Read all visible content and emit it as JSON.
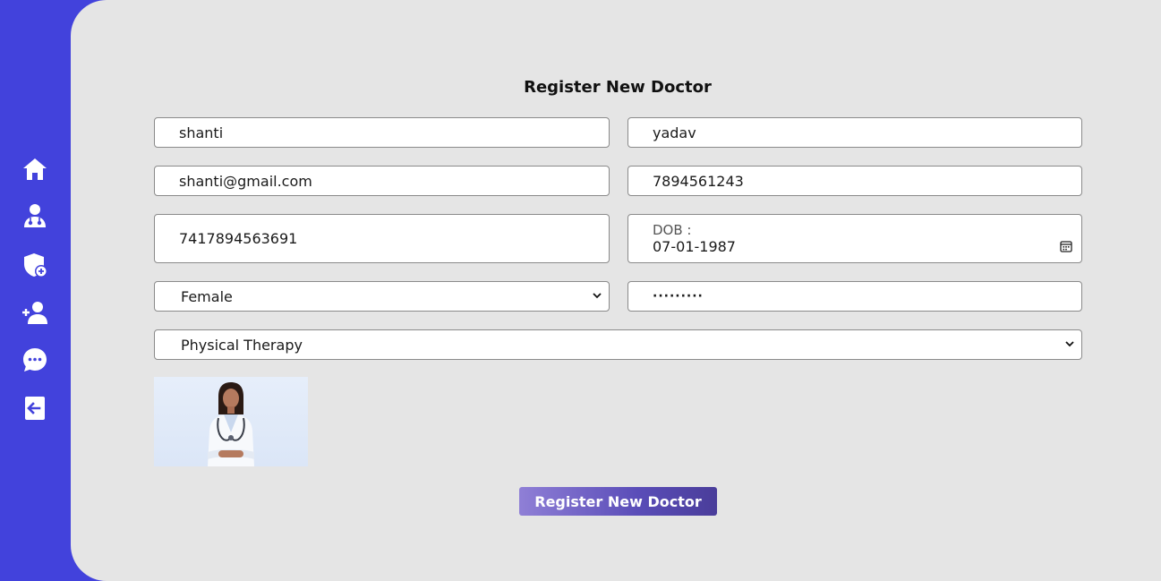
{
  "sidebar": {
    "items": [
      {
        "name": "home",
        "icon": "home-icon"
      },
      {
        "name": "doctors",
        "icon": "doctor-icon"
      },
      {
        "name": "add-department",
        "icon": "shield-plus-icon"
      },
      {
        "name": "add-user",
        "icon": "user-plus-icon"
      },
      {
        "name": "messages",
        "icon": "chat-icon"
      },
      {
        "name": "logout",
        "icon": "logout-icon"
      }
    ]
  },
  "form": {
    "title": "Register New Doctor",
    "first_name": "shanti",
    "last_name": "yadav",
    "email": "shanti@gmail.com",
    "phone": "7894561243",
    "id_number": "7417894563691",
    "dob_label": "DOB :",
    "dob": "07-01-1987",
    "gender": "Female",
    "password": "·········",
    "department": "Physical Therapy",
    "photo_icon": "doctor-photo",
    "submit_label": "Register New Doctor"
  },
  "colors": {
    "sidebar": "#4242dc",
    "main_bg": "#e5e5e5",
    "button_start": "#8f7fd6",
    "button_end": "#4a3d9a"
  }
}
